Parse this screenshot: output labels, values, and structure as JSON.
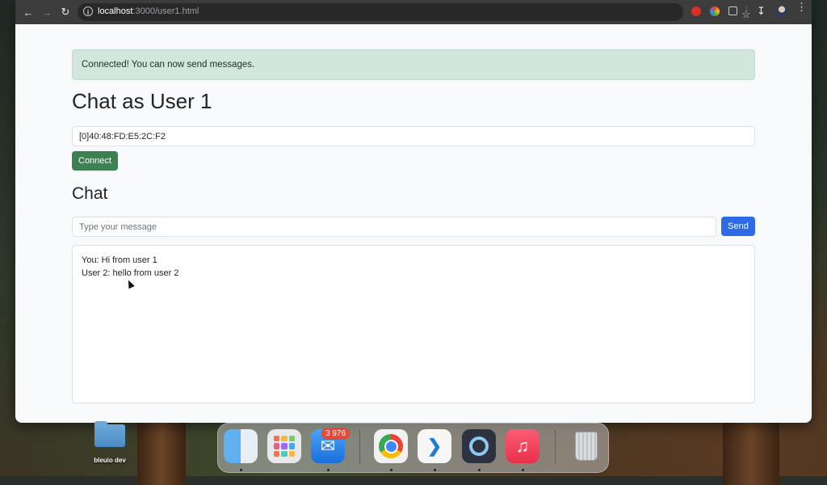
{
  "browser": {
    "url_host": "localhost",
    "url_path": ":3000/user1.html",
    "icons": [
      "back-arrow-icon",
      "forward-arrow-icon",
      "reload-icon",
      "site-info-icon",
      "bookmark-star-icon",
      "extension-icon",
      "chrome-extension-icon",
      "puzzle-icon",
      "download-icon",
      "profile-avatar",
      "menu-icon"
    ]
  },
  "page": {
    "alert_text": "Connected! You can now send messages.",
    "title": "Chat as User 1",
    "device_address_value": "[0]40:48:FD:E5:2C:F2",
    "connect_label": "Connect",
    "chat_heading": "Chat",
    "message_placeholder": "Type your message",
    "send_label": "Send",
    "messages": [
      "You: Hi from user 1",
      "User 2: hello from user 2"
    ]
  },
  "desktop": {
    "folder_label": "bleuio dev",
    "mail_badge": "3 976",
    "dock_apps": [
      "finder",
      "launchpad",
      "mail",
      "chrome",
      "vscode",
      "quicktime",
      "music",
      "trash"
    ]
  },
  "colors": {
    "alert_bg": "#d1e7dd",
    "connect_btn": "#3d8051",
    "send_btn": "#2f6ae6",
    "page_bg": "#f8f9fa"
  }
}
